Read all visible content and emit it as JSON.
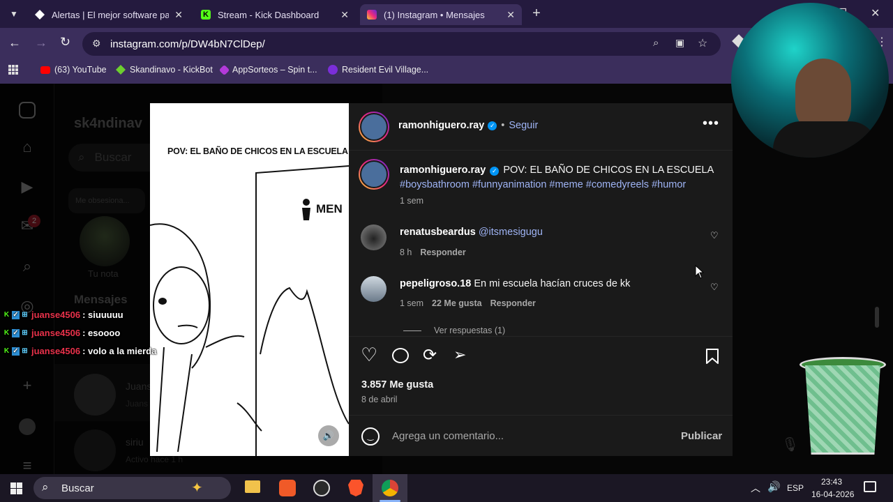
{
  "tabs": [
    {
      "title": "Alertas | El mejor software para",
      "icon": "alertas-icon",
      "active": false
    },
    {
      "title": "Stream - Kick Dashboard",
      "icon": "kick-icon",
      "active": false
    },
    {
      "title": "(1) Instagram • Mensajes",
      "icon": "instagram-icon",
      "active": true
    }
  ],
  "address": {
    "url": "instagram.com/p/DW4bN7ClDep/"
  },
  "bookmarks": [
    {
      "label": "(63) YouTube",
      "color": "#ff0000"
    },
    {
      "label": "Skandinavo - KickBot",
      "color": "#6dcf2f"
    },
    {
      "label": "AppSorteos – Spin t...",
      "color": "#b23ad9"
    },
    {
      "label": "Resident Evil Village...",
      "color": "#7b2ed9"
    }
  ],
  "inbox": {
    "username": "sk4ndinav",
    "search_placeholder": "Buscar",
    "note_bubble": "Me obsesiona...",
    "note_label": "Tu nota",
    "messages_title": "Mensajes",
    "notif_count": "2",
    "conversations": [
      {
        "name": "Juans",
        "sub": "Juans"
      },
      {
        "name": "siriu",
        "sub": "Activo hace 1 h"
      }
    ]
  },
  "media": {
    "caption": "POV: EL BAÑO DE CHICOS EN LA ESCUELA",
    "door_sign": "MEN"
  },
  "post": {
    "author": "ramonhiguero.ray",
    "follow": "Seguir",
    "caption_text": "POV: EL BAÑO DE CHICOS EN LA ESCUELA",
    "hashtags": "#boysbathroom #funnyanimation #meme #comedyreels #humor",
    "caption_time": "1 sem",
    "likes": "3.857 Me gusta",
    "date": "8 de abril",
    "comment_placeholder": "Agrega un comentario...",
    "publish": "Publicar"
  },
  "comments": [
    {
      "user": "renatusbeardus",
      "text": "@itsmesigugu",
      "time": "8 h",
      "likes": "",
      "reply": "Responder"
    },
    {
      "user": "pepeligroso.18",
      "text": "En mi escuela hacían cruces de kk",
      "time": "1 sem",
      "likes": "22 Me gusta",
      "reply": "Responder"
    }
  ],
  "view_replies": "Ver respuestas (1)",
  "chat": [
    {
      "user": "juanse4506",
      "msg": ": siuuuuu"
    },
    {
      "user": "juanse4506",
      "msg": ": esoooo"
    },
    {
      "user": "juanse4506",
      "msg": ": volo a la mierda"
    }
  ],
  "taskbar": {
    "search": "Buscar",
    "lang": "ESP",
    "time": "23:43",
    "date": "16-04-2026"
  },
  "colors": {
    "accent": "#3b2e5c",
    "verified": "#0095f6",
    "link": "#9fb4f5",
    "chat_user": "#e8314a"
  }
}
